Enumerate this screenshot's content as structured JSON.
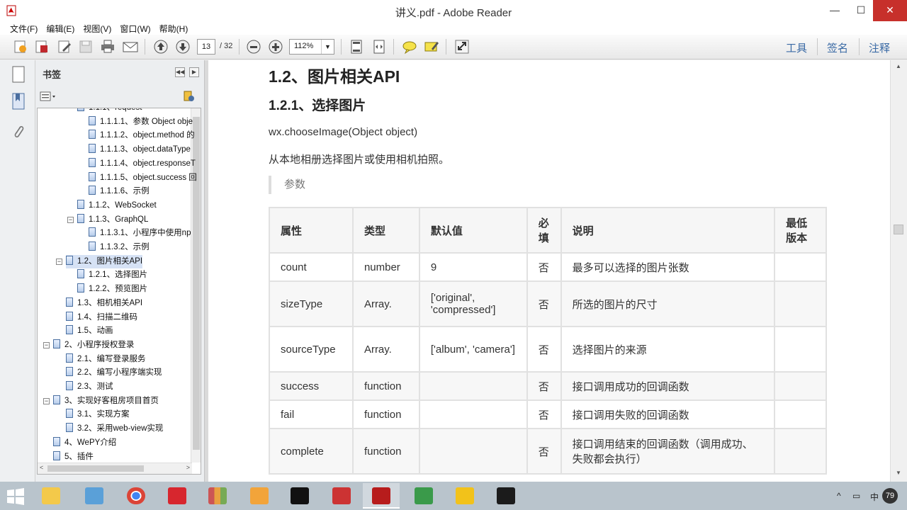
{
  "window": {
    "title": "讲义.pdf - Adobe Reader",
    "min_label": "—",
    "max_label": "☐",
    "close_label": "✕"
  },
  "menu": [
    "文件(F)",
    "编辑(E)",
    "视图(V)",
    "窗口(W)",
    "帮助(H)"
  ],
  "toolbar": {
    "page_current": "13",
    "page_total": "/ 32",
    "zoom": "112%",
    "tools_label": "工具",
    "sign_label": "签名",
    "comment_label": "注释"
  },
  "bookmarks": {
    "title": "书签",
    "collapse_label": "◀◀",
    "expand_label": "▶",
    "items": [
      {
        "label": "1.1.1、request",
        "level": 2
      },
      {
        "label": "1.1.1.1、参数 Object obje",
        "level": 3
      },
      {
        "label": "1.1.1.2、object.method 的",
        "level": 3
      },
      {
        "label": "1.1.1.3、object.dataType",
        "level": 3
      },
      {
        "label": "1.1.1.4、object.responseT",
        "level": 3
      },
      {
        "label": "1.1.1.5、object.success 回",
        "level": 3
      },
      {
        "label": "1.1.1.6、示例",
        "level": 3
      },
      {
        "label": "1.1.2、WebSocket",
        "level": 2
      },
      {
        "label": "1.1.3、GraphQL",
        "level": 2
      },
      {
        "label": "1.1.3.1、小程序中使用np",
        "level": 3
      },
      {
        "label": "1.1.3.2、示例",
        "level": 3
      },
      {
        "label": "1.2、图片相关API",
        "level": 1
      },
      {
        "label": "1.2.1、选择图片",
        "level": 2
      },
      {
        "label": "1.2.2、预览图片",
        "level": 2
      },
      {
        "label": "1.3、相机相关API",
        "level": 1
      },
      {
        "label": "1.4、扫描二维码",
        "level": 1
      },
      {
        "label": "1.5、动画",
        "level": 1
      },
      {
        "label": "2、小程序授权登录",
        "level": 0
      },
      {
        "label": "2.1、编写登录服务",
        "level": 1
      },
      {
        "label": "2.2、编写小程序端实现",
        "level": 1
      },
      {
        "label": "2.3、测试",
        "level": 1
      },
      {
        "label": "3、实现好客租房项目首页",
        "level": 0
      },
      {
        "label": "3.1、实现方案",
        "level": 1
      },
      {
        "label": "3.2、采用web-view实现",
        "level": 1
      },
      {
        "label": "4、WePY介绍",
        "level": 0
      },
      {
        "label": "5、插件",
        "level": 0
      }
    ]
  },
  "document": {
    "h2": "1.2、图片相关API",
    "h3": "1.2.1、选择图片",
    "api": "wx.chooseImage(Object object)",
    "desc": "从本地相册选择图片或使用相机拍照。",
    "quote": "参数",
    "table": {
      "headers": [
        "属性",
        "类型",
        "默认值",
        "必填",
        "说明",
        "最低版本"
      ],
      "rows": [
        [
          "count",
          "number",
          "9",
          "否",
          "最多可以选择的图片张数",
          ""
        ],
        [
          "sizeType",
          "Array.",
          "['original', 'compressed']",
          "否",
          "所选的图片的尺寸",
          ""
        ],
        [
          "sourceType",
          "Array.",
          "['album', 'camera']",
          "否",
          "选择图片的来源",
          ""
        ],
        [
          "success",
          "function",
          "",
          "否",
          "接口调用成功的回调函数",
          ""
        ],
        [
          "fail",
          "function",
          "",
          "否",
          "接口调用失败的回调函数",
          ""
        ],
        [
          "complete",
          "function",
          "",
          "否",
          "接口调用结束的回调函数（调用成功、失败都会执行）",
          ""
        ]
      ]
    }
  },
  "taskbar": {
    "tray_ime": "中",
    "tray_badge": "79"
  }
}
